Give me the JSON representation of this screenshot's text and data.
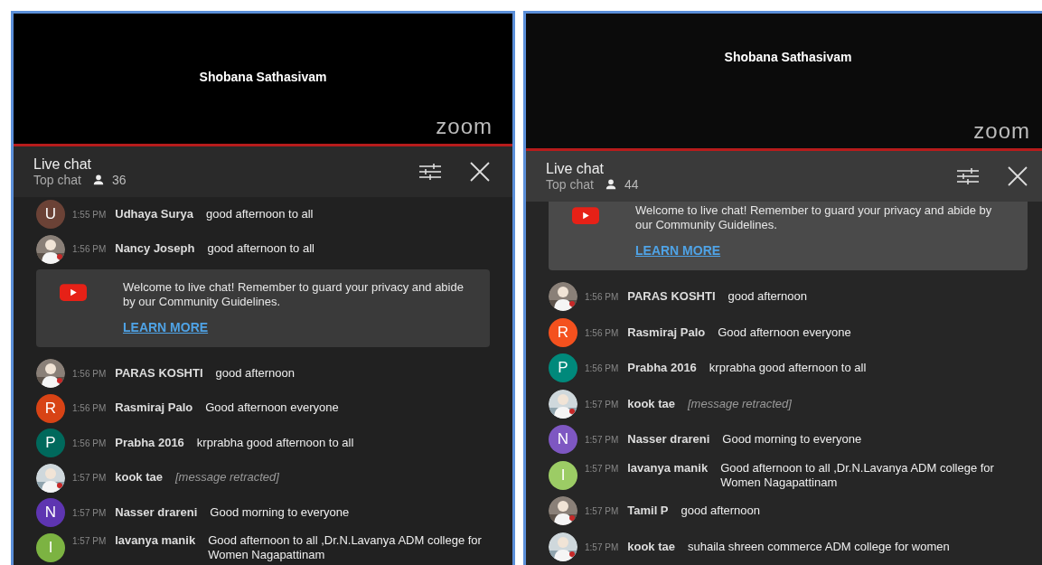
{
  "panels": [
    {
      "video": {
        "speaker": "Shobana Sathasivam",
        "logo": "zoom"
      },
      "chat": {
        "title": "Live chat",
        "mode": "Top chat",
        "viewers": "36"
      },
      "items": [
        {
          "kind": "message",
          "avatar": {
            "kind": "letter",
            "letter": "U",
            "color": "#6b4236"
          },
          "time": "1:55 PM",
          "author": "Udhaya Surya",
          "text": "good afternoon to all",
          "retracted": false
        },
        {
          "kind": "message",
          "time": "1:56 PM",
          "author": "Nancy Joseph",
          "text": "good afternoon to all",
          "retracted": false
        },
        {
          "kind": "notice",
          "text": "Welcome to live chat! Remember to guard your privacy and abide by our Community Guidelines.",
          "link": "LEARN MORE"
        },
        {
          "kind": "message",
          "time": "1:56 PM",
          "author": "PARAS KOSHTI",
          "text": "good afternoon",
          "retracted": false
        },
        {
          "kind": "message",
          "avatar": {
            "kind": "letter",
            "letter": "R",
            "color": "#d84315"
          },
          "time": "1:56 PM",
          "author": "Rasmiraj Palo",
          "text": "Good afternoon everyone",
          "retracted": false
        },
        {
          "kind": "message",
          "avatar": {
            "kind": "letter",
            "letter": "P",
            "color": "#00695c"
          },
          "time": "1:56 PM",
          "author": "Prabha 2016",
          "text": "krprabha good afternoon to all",
          "retracted": false
        },
        {
          "kind": "message",
          "time": "1:57 PM",
          "author": "kook tae",
          "text": "[message retracted]",
          "retracted": true
        },
        {
          "kind": "message",
          "avatar": {
            "kind": "letter",
            "letter": "N",
            "color": "#5e35b1"
          },
          "time": "1:57 PM",
          "author": "Nasser drareni",
          "text": "Good morning to everyone",
          "retracted": false
        },
        {
          "kind": "message",
          "avatar": {
            "kind": "letter",
            "letter": "I",
            "color": "#7cb342"
          },
          "time": "1:57 PM",
          "author": "lavanya manik",
          "text": "Good afternoon to all ,Dr.N.Lavanya ADM college for Women Nagapattinam",
          "retracted": false
        }
      ]
    },
    {
      "video": {
        "speaker": "Shobana Sathasivam",
        "logo": "zoom"
      },
      "chat": {
        "title": "Live chat",
        "mode": "Top chat",
        "viewers": "44"
      },
      "items": [
        {
          "kind": "notice",
          "text": "Welcome to live chat! Remember to guard your privacy and abide by our Community Guidelines.",
          "link": "LEARN MORE"
        },
        {
          "kind": "message",
          "time": "1:56 PM",
          "author": "PARAS KOSHTI",
          "text": "good afternoon",
          "retracted": false
        },
        {
          "kind": "message",
          "avatar": {
            "kind": "letter",
            "letter": "R",
            "color": "#f4511e"
          },
          "time": "1:56 PM",
          "author": "Rasmiraj Palo",
          "text": "Good afternoon everyone",
          "retracted": false
        },
        {
          "kind": "message",
          "avatar": {
            "kind": "letter",
            "letter": "P",
            "color": "#00897b"
          },
          "time": "1:56 PM",
          "author": "Prabha 2016",
          "text": "krprabha good afternoon to all",
          "retracted": false
        },
        {
          "kind": "message",
          "time": "1:57 PM",
          "author": "kook tae",
          "text": "[message retracted]",
          "retracted": true
        },
        {
          "kind": "message",
          "avatar": {
            "kind": "letter",
            "letter": "N",
            "color": "#7e57c2"
          },
          "time": "1:57 PM",
          "author": "Nasser drareni",
          "text": "Good morning to everyone",
          "retracted": false
        },
        {
          "kind": "message",
          "avatar": {
            "kind": "letter",
            "letter": "I",
            "color": "#9ccc65"
          },
          "time": "1:57 PM",
          "author": "lavanya manik",
          "text": "Good afternoon to all ,Dr.N.Lavanya ADM college for Women Nagapattinam",
          "retracted": false
        },
        {
          "kind": "message",
          "time": "1:57 PM",
          "author": "Tamil P",
          "text": "good afternoon",
          "retracted": false
        },
        {
          "kind": "message",
          "time": "1:57 PM",
          "author": "kook tae",
          "text": "suhaila shreen commerce ADM college for women",
          "retracted": false
        }
      ]
    }
  ]
}
